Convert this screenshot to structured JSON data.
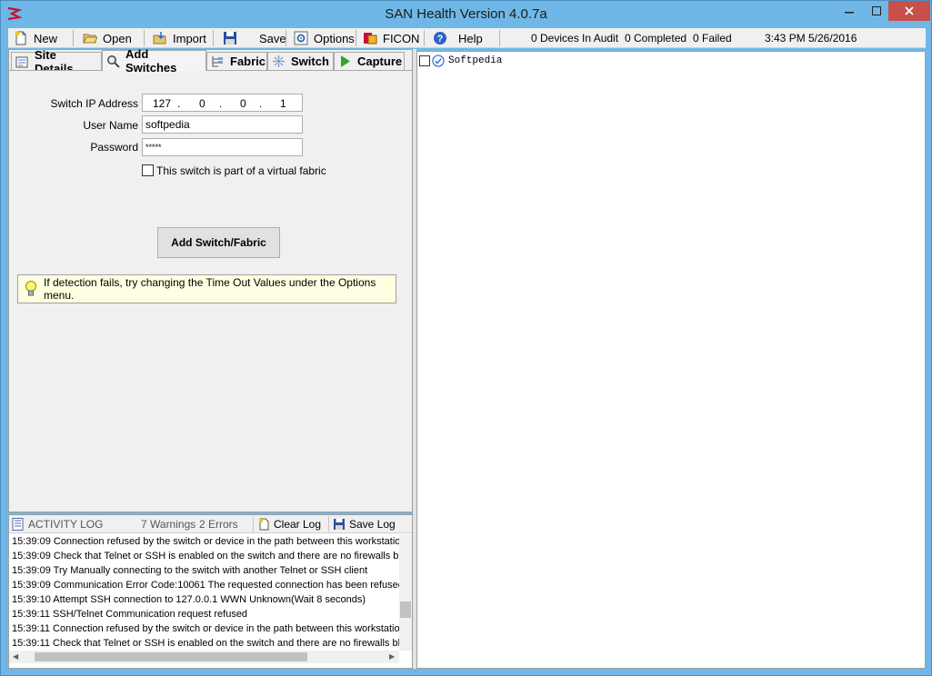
{
  "window": {
    "title": "SAN Health Version 4.0.7a"
  },
  "toolbar": {
    "new_label": "New",
    "open_label": "Open",
    "import_label": "Import",
    "save_label": "Save",
    "options_label": "Options",
    "ficon_label": "FICON",
    "help_label": "Help",
    "status": {
      "devices": "0 Devices In Audit",
      "completed": "0 Completed",
      "failed": "0 Failed",
      "time": "3:43 PM",
      "date": "5/26/2016"
    }
  },
  "tabs": [
    {
      "label": "Site Details",
      "icon": "site-details-icon"
    },
    {
      "label": "Add Switches",
      "icon": "search-icon"
    },
    {
      "label": "Fabric",
      "icon": "fabric-icon"
    },
    {
      "label": "Switch",
      "icon": "switch-icon"
    },
    {
      "label": "Capture",
      "icon": "play-icon"
    }
  ],
  "form": {
    "ip_label": "Switch IP Address",
    "ip_segments": [
      "127",
      "0",
      "0",
      "1"
    ],
    "ip_separator": ".",
    "user_label": "User Name",
    "user_value": "softpedia",
    "password_label": "Password",
    "password_value": "*****",
    "virtual_fabric_label": "This switch is part of a virtual fabric",
    "virtual_fabric_checked": false,
    "add_button_label": "Add Switch/Fabric",
    "hint": "If detection fails, try changing the Time Out Values under the Options menu."
  },
  "log": {
    "title": "ACTIVITY LOG",
    "warnings": "7 Warnings",
    "errors": "2 Errors",
    "clear_label": "Clear Log",
    "save_label": "Save Log",
    "lines": [
      "15:39:09 Connection refused by the switch or device in the path between this workstation",
      "15:39:09 Check that Telnet or SSH is enabled on the switch and there are no firewalls blocking",
      "15:39:09 Try Manually connecting to the switch with another Telnet or SSH client",
      "15:39:09 Communication Error Code:10061 The requested connection has been refused",
      "15:39:10 Attempt SSH connection to 127.0.0.1 WWN Unknown(Wait 8 seconds)",
      "15:39:11 SSH/Telnet Communication request refused",
      "15:39:11 Connection refused by the switch or device in the path between this workstation",
      "15:39:11 Check that Telnet or SSH is enabled on the switch and there are no firewalls blocking"
    ]
  },
  "tree": {
    "items": [
      {
        "label": "Softpedia",
        "checked": false
      }
    ]
  },
  "colors": {
    "titlebar": "#6fb7e6",
    "close": "#c7504b",
    "hint_bg": "#ffffe1"
  }
}
